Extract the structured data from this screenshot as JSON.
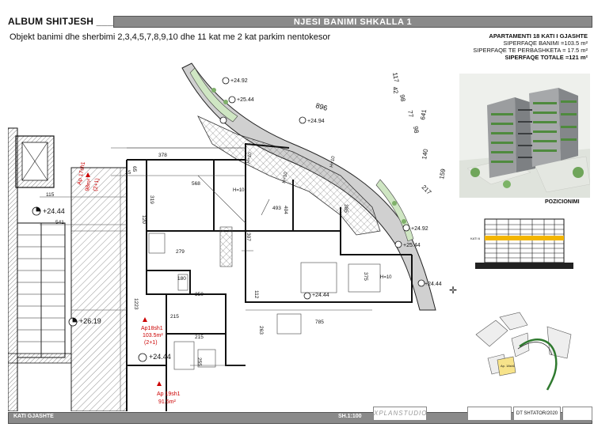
{
  "header": {
    "album_title": "ALBUM SHITJESH ____",
    "unit_title": "NJESI BANIMI  SHKALLA 1",
    "subtitle": "Objekt banimi dhe sherbimi 2,3,4,5,7,8,9,10 dhe 11 kat me 2 kat parkim nentokesor"
  },
  "apartment_info": {
    "name": "APARTAMENTI 18 KATI I GJASHTE",
    "living_area": "SIPERFAQE BANIMI =103.5 m²",
    "shared_area": "SIPERFAQE TE PERBASHKETA = 17.5 m²",
    "total_area": "SIPERFAQE TOTALE =121 m²"
  },
  "side_panel": {
    "render_label": "building-render",
    "pozicionimi": "POZICIONIMI",
    "section_level": "KATI 6",
    "site_unit_label": "Ap. 18sh1"
  },
  "plan": {
    "levels": [
      "+24.44",
      "+24.44",
      "+26.19",
      "+24.92",
      "+25.44",
      "+24.94",
      "+24.92",
      "+25.44",
      "+24.44",
      "+24.44",
      "+24.44"
    ],
    "apartments": [
      {
        "name": "Ap 17sh1",
        "area": "98m²",
        "type": "(2+1)"
      },
      {
        "name": "Ap18sh1",
        "area": "103.5m²",
        "type": "(2+1)"
      },
      {
        "name": "Ap 19sh1",
        "area": "91.5m²"
      }
    ],
    "dimensions": [
      "115",
      "541",
      "378",
      "568",
      "319",
      "120",
      "279",
      "180",
      "350",
      "493",
      "404",
      "307",
      "385",
      "375",
      "785",
      "263",
      "215",
      "215",
      "255",
      "1223",
      "112",
      "896",
      "641",
      "217",
      "140",
      "159",
      "65",
      "15"
    ],
    "road_numbers": [
      "117",
      "42",
      "98",
      "77",
      "98"
    ],
    "heights": [
      "H=10",
      "H=10",
      "H=10",
      "H=10",
      "H=10"
    ]
  },
  "footer": {
    "floor": "KATI GJASHTE",
    "scale": "SH.1:100",
    "logo": "XPLANSTUDIO",
    "date": "DT SHTATOR/2020"
  },
  "colors": {
    "bar": "#8a8a8a",
    "accent_red": "#cc0000",
    "hatch": "#777777",
    "green": "#8cc07a",
    "highlight": "#f7e38a"
  }
}
